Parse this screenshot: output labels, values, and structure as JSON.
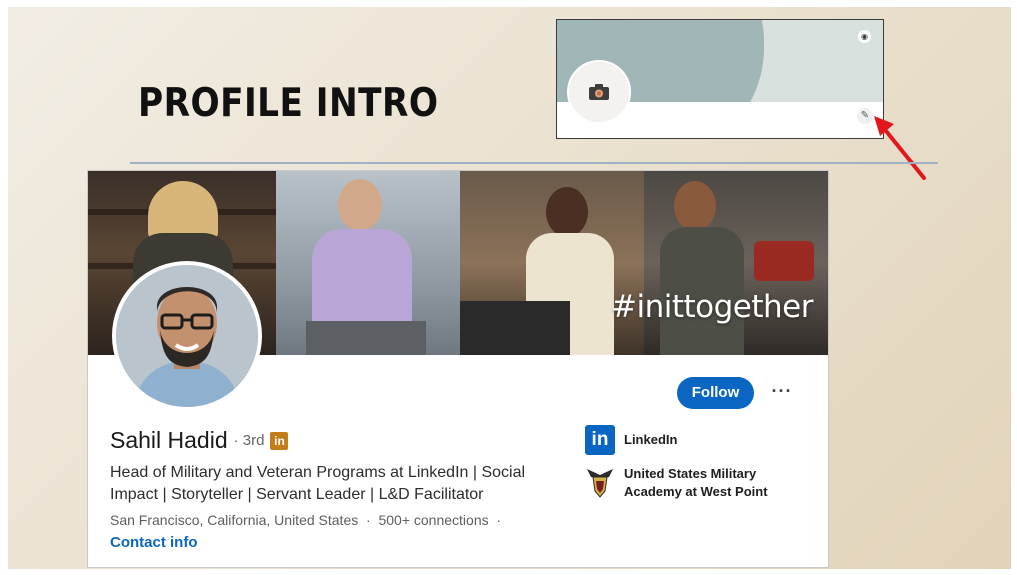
{
  "slide": {
    "title": "PROFILE INTRO"
  },
  "inset": {
    "camera_icon": "camera-icon",
    "small_camera_icon": "camera-icon",
    "edit_icon": "pencil-icon",
    "arrow_color": "#e3161b"
  },
  "profile": {
    "cover_hashtag": "#inittogether",
    "name": "Sahil Hadid",
    "degree": "· 3rd",
    "badge_text": "in",
    "headline": "Head of Military and Veteran Programs at LinkedIn | Social Impact | Storyteller | Servant Leader | L&D Facilitator",
    "location": "San Francisco, California, United States",
    "connections": "500+ connections",
    "separator": "·",
    "contact_info": "Contact info",
    "follow_label": "Follow",
    "more_label": "···",
    "accent_color": "#0a66c2",
    "orgs": [
      {
        "name": "LinkedIn",
        "logo_text": "in",
        "icon": "linkedin-logo-icon"
      },
      {
        "name": "United States Military Academy at West Point",
        "icon": "usma-crest-icon"
      }
    ]
  }
}
